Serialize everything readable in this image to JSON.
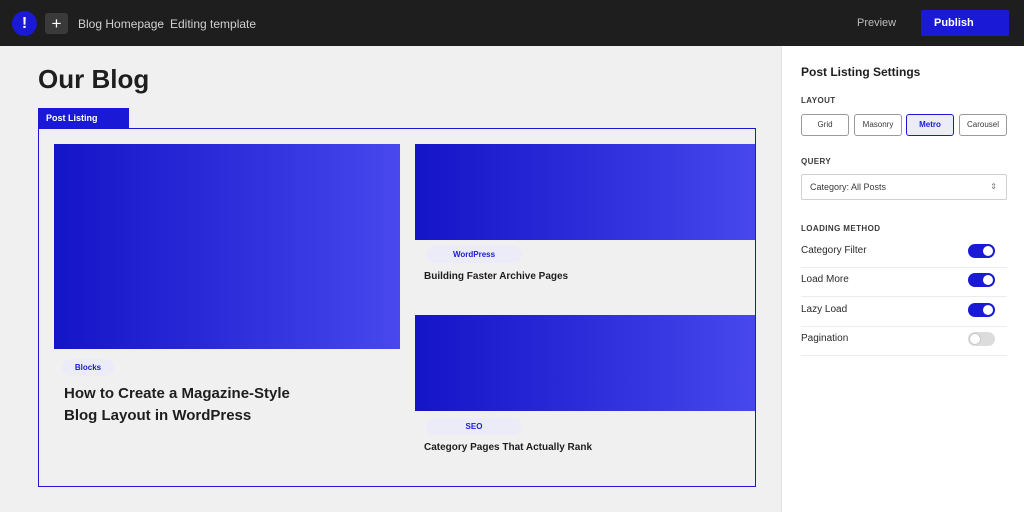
{
  "header": {
    "logo_glyph": "!",
    "add_glyph": "+",
    "breadcrumb": {
      "page": "Blog Homepage",
      "separator": "·",
      "mode": "Editing template"
    },
    "preview_label": "Preview",
    "publish_label": "Publish"
  },
  "canvas": {
    "page_title": "Our Blog",
    "block_label": "Post Listing",
    "posts": [
      {
        "category": "Blocks",
        "title": "How to Create a Magazine-Style Blog Layout in WordPress"
      },
      {
        "category": "WordPress",
        "title": "Building Faster Archive Pages"
      },
      {
        "category": "SEO",
        "title": "Category Pages That Actually Rank"
      }
    ]
  },
  "panel": {
    "title": "Post Listing Settings",
    "layout": {
      "label": "LAYOUT",
      "options": [
        "Grid",
        "Masonry",
        "Metro",
        "Carousel"
      ],
      "selected": "Metro"
    },
    "query": {
      "label": "QUERY",
      "value": "Category: All Posts"
    },
    "loading_method": {
      "label": "LOADING METHOD",
      "toggles": [
        {
          "label": "Category Filter",
          "on": true
        },
        {
          "label": "Load More",
          "on": true
        },
        {
          "label": "Lazy Load",
          "on": true
        },
        {
          "label": "Pagination",
          "on": false
        }
      ]
    }
  },
  "colors": {
    "accent": "#1a1ad6",
    "topbar": "#1e1e1e",
    "canvas_bg": "#f0f0f0",
    "gradient_start": "#1515c8",
    "gradient_end": "#4848ee"
  }
}
